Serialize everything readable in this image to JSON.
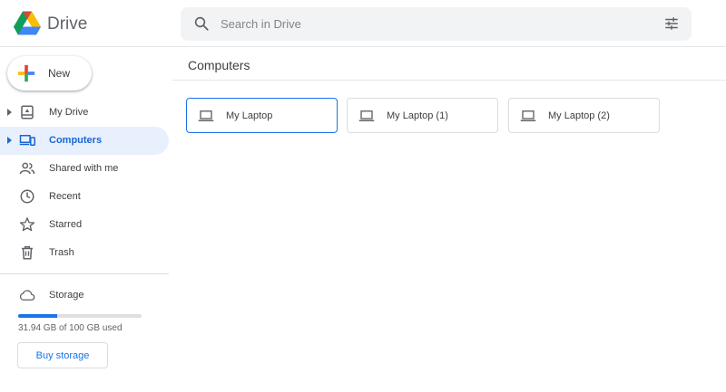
{
  "header": {
    "brand": "Drive",
    "search": {
      "placeholder": "Search in Drive",
      "value": ""
    },
    "icons": [
      "drive-logo-icon",
      "search-icon",
      "tune-icon"
    ]
  },
  "sidebar": {
    "new_label": "New",
    "items": [
      {
        "label": "My Drive",
        "icon": "my-drive-icon",
        "expandable": true,
        "active": false
      },
      {
        "label": "Computers",
        "icon": "computers-icon",
        "expandable": true,
        "active": true
      },
      {
        "label": "Shared with me",
        "icon": "people-icon",
        "expandable": false,
        "active": false
      },
      {
        "label": "Recent",
        "icon": "clock-icon",
        "expandable": false,
        "active": false
      },
      {
        "label": "Starred",
        "icon": "star-icon",
        "expandable": false,
        "active": false
      },
      {
        "label": "Trash",
        "icon": "trash-icon",
        "expandable": false,
        "active": false
      }
    ],
    "storage": {
      "label": "Storage",
      "icon": "cloud-icon",
      "used_fraction": 0.3194,
      "usage_text": "31.94 GB of 100 GB used",
      "buy_label": "Buy storage"
    }
  },
  "main": {
    "title": "Computers",
    "computers": [
      {
        "label": "My Laptop",
        "selected": true
      },
      {
        "label": "My Laptop (1)",
        "selected": false
      },
      {
        "label": "My Laptop (2)",
        "selected": false
      }
    ]
  },
  "colors": {
    "accent": "#1a73e8",
    "active_bg": "#e8f0fe",
    "active_text": "#1967d2",
    "search_bg": "#f1f3f4"
  }
}
